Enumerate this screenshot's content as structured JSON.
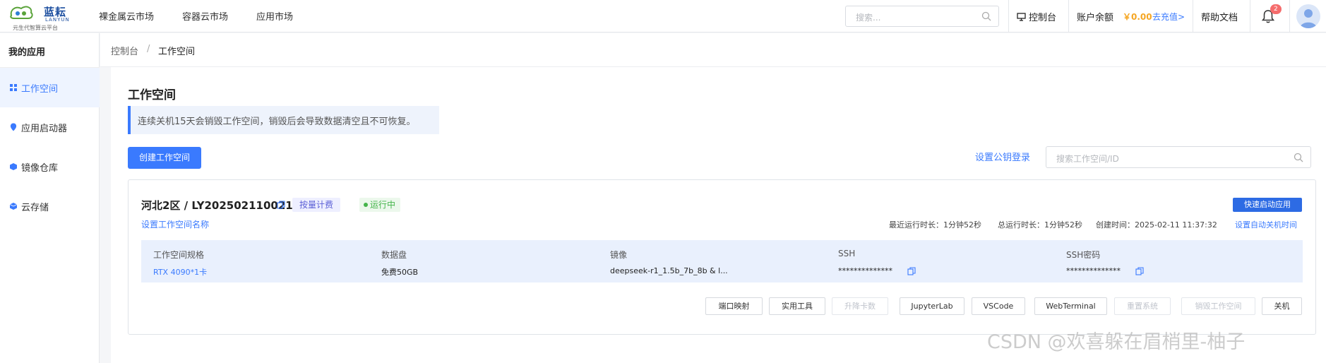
{
  "logo": {
    "name": "蓝耘",
    "en": "LANYUN",
    "tagline": "元生代智算云平台"
  },
  "topnav": [
    "裸金属云市场",
    "容器云市场",
    "应用市场"
  ],
  "search": {
    "placeholder": "搜索..."
  },
  "topbar": {
    "console": "控制台",
    "balance_label": "账户余额",
    "balance_value": "￥0.00",
    "recharge": "去充值>",
    "help": "帮助文档",
    "notification_count": "2"
  },
  "sidebar": {
    "title": "我的应用",
    "items": [
      {
        "label": "工作空间",
        "icon": "workspace-icon",
        "active": true
      },
      {
        "label": "应用启动器",
        "icon": "launcher-icon",
        "active": false
      },
      {
        "label": "镜像仓库",
        "icon": "image-repo-icon",
        "active": false
      },
      {
        "label": "云存储",
        "icon": "cloud-storage-icon",
        "active": false
      }
    ]
  },
  "breadcrumb": [
    "控制台",
    "工作空间"
  ],
  "page": {
    "title": "工作空间",
    "notice": "连续关机15天会销毁工作空间，销毁后会导致数据清空且不可恢复。",
    "create_button": "创建工作空间",
    "key_login_link": "设置公钥登录",
    "ws_search_placeholder": "搜索工作空间/ID"
  },
  "workspace": {
    "title": "河北2区 / LY2025021100212",
    "billing_tag": "按量计费",
    "status": "运行中",
    "quick_launch": "快速启动应用",
    "rename_link": "设置工作空间名称",
    "last_run": "最近运行时长：1分钟52秒",
    "total_run": "总运行时长：1分钟52秒",
    "created": "创建时间：2025-02-11 11:37:32",
    "auto_shutdown": "设置自动关机时间",
    "specs": {
      "headers": [
        "工作空间规格",
        "数据盘",
        "镜像",
        "SSH",
        "SSH密码"
      ],
      "values": [
        "RTX 4090*1卡",
        "免费50GB",
        "deepseek-r1_1.5b_7b_8b & l...",
        "**************",
        "**************"
      ]
    },
    "actions": [
      {
        "label": "端口映射",
        "disabled": false
      },
      {
        "label": "实用工具",
        "disabled": false
      },
      {
        "label": "升降卡数",
        "disabled": true
      },
      {
        "label": "JupyterLab",
        "disabled": false
      },
      {
        "label": "VSCode",
        "disabled": false
      },
      {
        "label": "WebTerminal",
        "disabled": false
      },
      {
        "label": "重置系统",
        "disabled": true
      },
      {
        "label": "销毁工作空间",
        "disabled": true
      },
      {
        "label": "关机",
        "disabled": false
      }
    ]
  },
  "watermark": "CSDN @欢喜躲在眉梢里-柚子",
  "colors": {
    "primary": "#3a7afe",
    "status_green": "#44b44a",
    "balance_orange": "#f5a623",
    "badge_red": "#f56c6c"
  }
}
